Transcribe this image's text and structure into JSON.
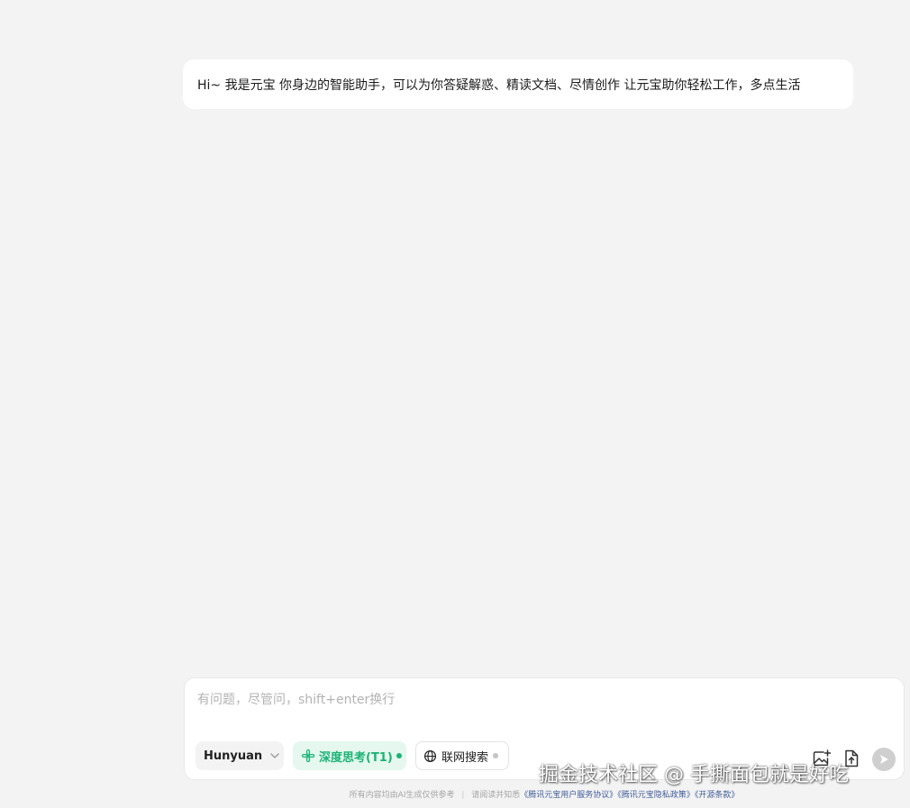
{
  "chat": {
    "greeting": "Hi~ 我是元宝 你身边的智能助手，可以为你答疑解惑、精读文档、尽情创作 让元宝助你轻松工作，多点生活"
  },
  "composer": {
    "placeholder": "有问题，尽管问，shift+enter换行",
    "value": "",
    "model_label": "Hunyuan",
    "deep_think_label": "深度思考(T1)",
    "deep_think_active": true,
    "web_search_label": "联网搜索",
    "web_search_active": false
  },
  "footer": {
    "disclaimer": "所有内容均由AI生成仅供参考",
    "separator": "|",
    "notice": "请阅读并知悉",
    "links": [
      "《腾讯元宝用户服务协议》",
      "《腾讯元宝隐私政策》",
      "《开源条款》"
    ]
  },
  "watermark": "掘金技术社区 @ 手撕面包就是好吃",
  "colors": {
    "background": "#f3f3f3",
    "accent_green": "#1bb375",
    "link": "#3f5d9a"
  },
  "icons": {
    "model_dropdown": "chevron-down-icon",
    "deep_think": "atom-icon",
    "web_search": "globe-icon",
    "image_upload": "image-add-icon",
    "file_upload": "file-upload-icon",
    "send": "send-icon"
  }
}
